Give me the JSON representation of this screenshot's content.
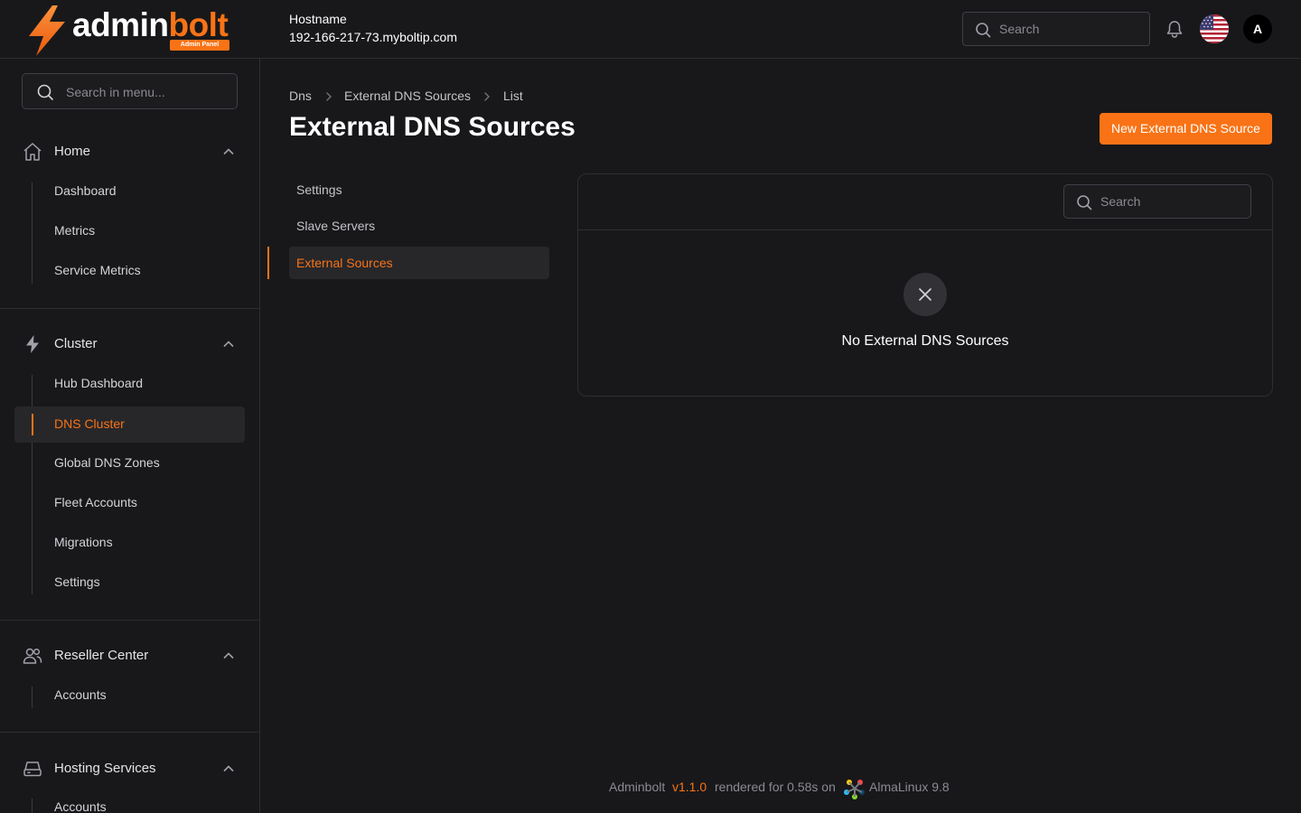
{
  "brand": {
    "name_part1": "admin",
    "name_part2": "bolt",
    "badge": "Admin Panel"
  },
  "header": {
    "hostname_label": "Hostname",
    "hostname_value": "192-166-217-73.myboltip.com",
    "search_placeholder": "Search",
    "avatar_initial": "A",
    "flag": "us-flag-icon",
    "bell": "bell-icon"
  },
  "sidebar": {
    "search_placeholder": "Search in menu...",
    "groups": [
      {
        "label": "Home",
        "icon": "home-icon",
        "items": [
          "Dashboard",
          "Metrics",
          "Service Metrics"
        ]
      },
      {
        "label": "Cluster",
        "icon": "bolt-icon",
        "items": [
          "Hub Dashboard",
          "DNS Cluster",
          "Global DNS Zones",
          "Fleet Accounts",
          "Migrations",
          "Settings"
        ],
        "active_item": "DNS Cluster"
      },
      {
        "label": "Reseller Center",
        "icon": "users-icon",
        "items": [
          "Accounts"
        ]
      },
      {
        "label": "Hosting Services",
        "icon": "server-icon",
        "items": [
          "Accounts"
        ]
      }
    ]
  },
  "breadcrumb": [
    "Dns",
    "External DNS Sources",
    "List"
  ],
  "page": {
    "title": "External DNS Sources",
    "new_button": "New External DNS Source"
  },
  "subnav": {
    "items": [
      "Settings",
      "Slave Servers",
      "External Sources"
    ],
    "active": "External Sources"
  },
  "panel": {
    "search_placeholder": "Search",
    "empty_text": "No External DNS Sources"
  },
  "footer": {
    "app": "Adminbolt",
    "version": "v1.1.0",
    "rendered": "rendered for 0.58s on",
    "os": "AlmaLinux 9.8"
  },
  "colors": {
    "accent": "#f97316",
    "background": "#18181b",
    "surface": "#27272a",
    "border": "#2e2e32"
  }
}
